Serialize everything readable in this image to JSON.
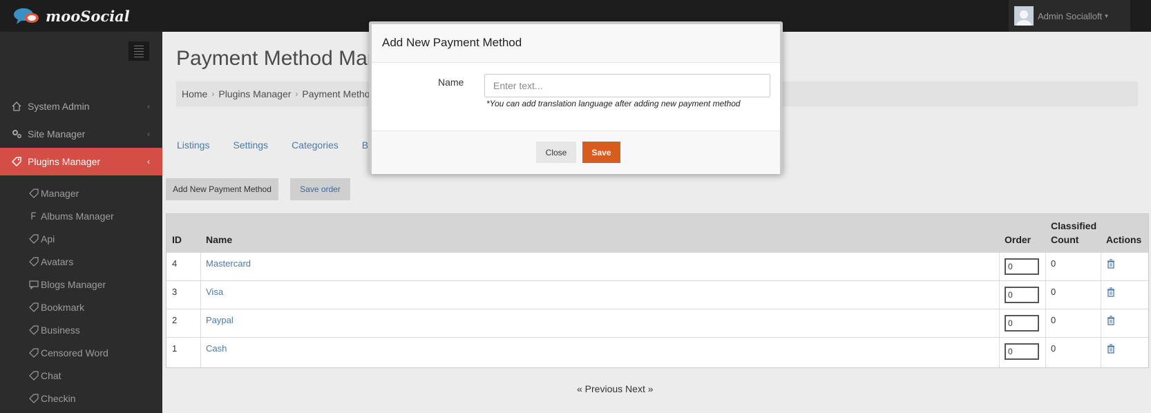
{
  "brand": {
    "name": "mooSocial"
  },
  "user": {
    "name": "Admin Socialloft"
  },
  "sidebar": {
    "items": [
      {
        "label": "System Admin",
        "icon": "home-icon"
      },
      {
        "label": "Site Manager",
        "icon": "gears-icon"
      },
      {
        "label": "Plugins Manager",
        "icon": "tag-icon"
      }
    ],
    "sub_items": [
      {
        "label": "Manager",
        "icon": "tag-icon"
      },
      {
        "label": "Albums Manager",
        "icon": "album-icon"
      },
      {
        "label": "Api",
        "icon": "tag-icon"
      },
      {
        "label": "Avatars",
        "icon": "tag-icon"
      },
      {
        "label": "Blogs Manager",
        "icon": "comment-icon"
      },
      {
        "label": "Bookmark",
        "icon": "tag-icon"
      },
      {
        "label": "Business",
        "icon": "tag-icon"
      },
      {
        "label": "Censored Word",
        "icon": "tag-icon"
      },
      {
        "label": "Chat",
        "icon": "tag-icon"
      },
      {
        "label": "Checkin",
        "icon": "tag-icon"
      }
    ]
  },
  "main": {
    "title": "Payment Method Mana",
    "breadcrumb": [
      "Home",
      "Plugins Manager",
      "Payment Metho"
    ],
    "tabs": [
      "Listings",
      "Settings",
      "Categories",
      "B"
    ],
    "add_button": "Add New Payment Method",
    "save_order_button": "Save order"
  },
  "table": {
    "headers": {
      "id": "ID",
      "name": "Name",
      "order": "Order",
      "count_line1": "Classified",
      "count_line2": "Count",
      "actions": "Actions"
    },
    "rows": [
      {
        "id": "4",
        "name": "Mastercard",
        "order": "0",
        "count": "0"
      },
      {
        "id": "3",
        "name": "Visa",
        "order": "0",
        "count": "0"
      },
      {
        "id": "2",
        "name": "Paypal",
        "order": "0",
        "count": "0"
      },
      {
        "id": "1",
        "name": "Cash",
        "order": "0",
        "count": "0"
      }
    ]
  },
  "pager": {
    "prev": "« Previous",
    "next": "Next »"
  },
  "modal": {
    "title": "Add New Payment Method",
    "name_label": "Name",
    "name_placeholder": "Enter text...",
    "hint": "*You can add translation language after adding new payment method",
    "close_label": "Close",
    "save_label": "Save"
  },
  "colors": {
    "active_menu": "#d44e45",
    "save_button": "#d95c1f",
    "link": "#4b7aa8"
  }
}
